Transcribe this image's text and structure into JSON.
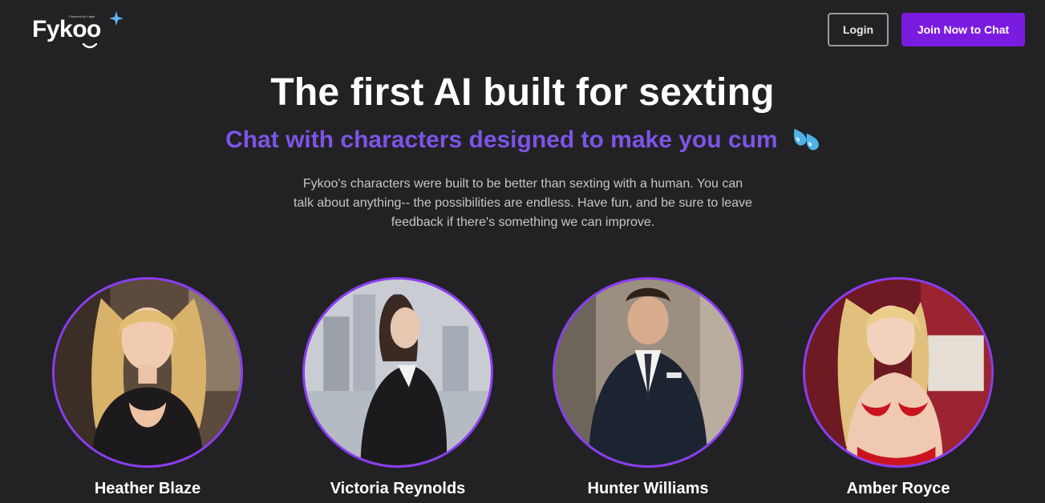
{
  "header": {
    "logo_text": "Fykoo",
    "logo_tagline": "Powered by Fagai",
    "login_label": "Login",
    "join_label": "Join Now to Chat"
  },
  "hero": {
    "title": "The first AI built for sexting",
    "subtitle": "Chat with characters designed to make you cum",
    "subtitle_emoji": "sweat-droplets-icon",
    "body": "Fykoo's characters were built to be better than sexting with a human. You can talk about anything-- the possibilities are endless. Have fun, and be sure to leave feedback if there's something we can improve."
  },
  "characters": [
    {
      "name": "Heather Blaze"
    },
    {
      "name": "Victoria Reynolds"
    },
    {
      "name": "Hunter Williams"
    },
    {
      "name": "Amber Royce"
    }
  ],
  "colors": {
    "background": "#222124",
    "accent": "#7a1be0",
    "subtitle": "#7b55e6",
    "ring": "#8a3df0"
  }
}
